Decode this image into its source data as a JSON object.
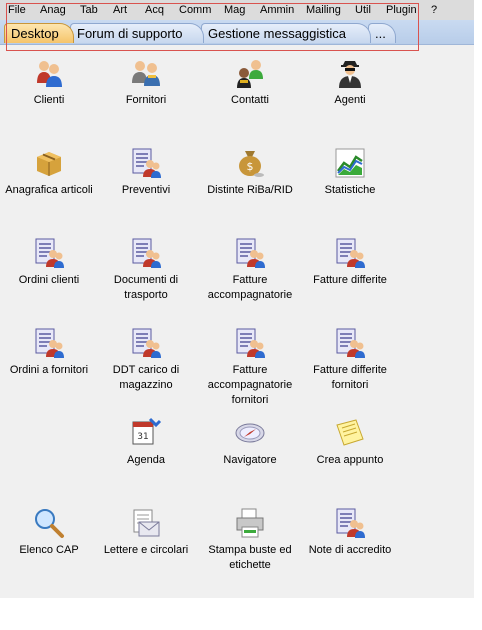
{
  "menu": [
    "File",
    "Anag",
    "Tab",
    "Art",
    "Acq",
    "Comm",
    "Mag",
    "Ammin",
    "Mailing",
    "Util",
    "Plugin",
    "?"
  ],
  "tabs": [
    "Desktop",
    "Forum di supporto",
    "Gestione messaggistica",
    "..."
  ],
  "icons": [
    {
      "label": "Clienti",
      "icon": "users-icon"
    },
    {
      "label": "Fornitori",
      "icon": "suppliers-icon"
    },
    {
      "label": "Contatti",
      "icon": "contacts-icon"
    },
    {
      "label": "Agenti",
      "icon": "agent-icon"
    },
    {
      "label": "Anagrafica articoli",
      "icon": "boxes-icon"
    },
    {
      "label": "Preventivi",
      "icon": "document-users-icon"
    },
    {
      "label": "Distinte RiBa/RID",
      "icon": "money-bag-icon"
    },
    {
      "label": "Statistiche",
      "icon": "chart-icon"
    },
    {
      "label": "Ordini clienti",
      "icon": "document-users-icon"
    },
    {
      "label": "Documenti di trasporto",
      "icon": "document-users-icon"
    },
    {
      "label": "Fatture accompagnatorie",
      "icon": "document-users-icon"
    },
    {
      "label": "Fatture differite",
      "icon": "document-users-icon"
    },
    {
      "label": "Ordini a fornitori",
      "icon": "document-users-icon"
    },
    {
      "label": "DDT carico di magazzino",
      "icon": "document-users-icon"
    },
    {
      "label": "Fatture accompagnatorie fornitori",
      "icon": "document-users-icon"
    },
    {
      "label": "Fatture differite fornitori",
      "icon": "document-users-icon"
    },
    {
      "label": "Agenda",
      "icon": "calendar-icon"
    },
    {
      "label": "Navigatore",
      "icon": "compass-icon"
    },
    {
      "label": "Crea appunto",
      "icon": "note-icon"
    },
    {
      "label": "Elenco CAP",
      "icon": "magnifier-icon"
    },
    {
      "label": "Lettere e circolari",
      "icon": "letter-icon"
    },
    {
      "label": "Stampa buste ed etichette",
      "icon": "printer-icon"
    },
    {
      "label": "Note di accredito",
      "icon": "document-users-icon"
    }
  ]
}
